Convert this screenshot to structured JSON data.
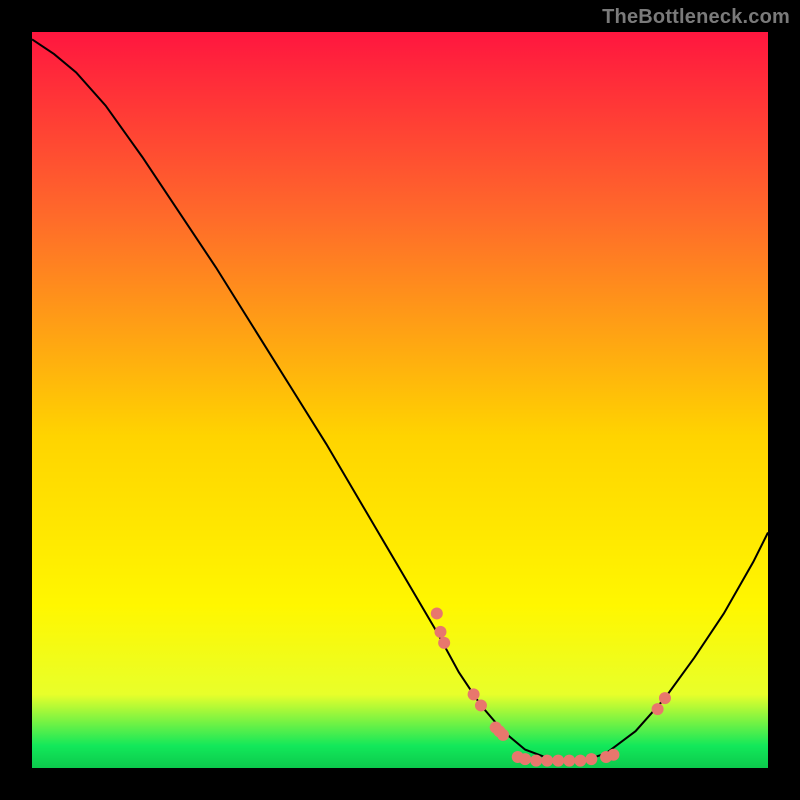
{
  "watermark": "TheBottleneck.com",
  "chart_data": {
    "type": "line",
    "title": "",
    "xlabel": "",
    "ylabel": "",
    "xlim": [
      0,
      100
    ],
    "ylim": [
      0,
      100
    ],
    "background_gradient": {
      "stops": [
        {
          "pct": 0,
          "color": "#ff163f"
        },
        {
          "pct": 25,
          "color": "#ff6a2a"
        },
        {
          "pct": 55,
          "color": "#ffd400"
        },
        {
          "pct": 78,
          "color": "#fff700"
        },
        {
          "pct": 90,
          "color": "#e8ff2a"
        },
        {
          "pct": 97,
          "color": "#12e85a"
        },
        {
          "pct": 100,
          "color": "#0cc94c"
        }
      ]
    },
    "series": [
      {
        "name": "bottleneck-curve",
        "color": "#000000",
        "x": [
          0,
          3,
          6,
          10,
          15,
          20,
          25,
          30,
          35,
          40,
          45,
          50,
          55,
          58,
          61,
          64,
          67,
          71,
          75,
          78,
          82,
          86,
          90,
          94,
          98,
          100
        ],
        "y": [
          99,
          97,
          94.5,
          90,
          83,
          75.5,
          68,
          60,
          52,
          44,
          35.5,
          27,
          18.5,
          13,
          8.5,
          5,
          2.5,
          1,
          1,
          2,
          5,
          9.5,
          15,
          21,
          28,
          32
        ]
      }
    ],
    "markers": {
      "name": "sample-points",
      "color": "#e8776d",
      "radius": 6,
      "points": [
        {
          "x": 55,
          "y": 21
        },
        {
          "x": 55.5,
          "y": 18.5
        },
        {
          "x": 56,
          "y": 17
        },
        {
          "x": 60,
          "y": 10
        },
        {
          "x": 61,
          "y": 8.5
        },
        {
          "x": 63,
          "y": 5.5
        },
        {
          "x": 63.5,
          "y": 5
        },
        {
          "x": 64,
          "y": 4.5
        },
        {
          "x": 66,
          "y": 1.5
        },
        {
          "x": 67,
          "y": 1.2
        },
        {
          "x": 68.5,
          "y": 1
        },
        {
          "x": 70,
          "y": 1
        },
        {
          "x": 71.5,
          "y": 1
        },
        {
          "x": 73,
          "y": 1
        },
        {
          "x": 74.5,
          "y": 1
        },
        {
          "x": 76,
          "y": 1.2
        },
        {
          "x": 78,
          "y": 1.5
        },
        {
          "x": 79,
          "y": 1.8
        },
        {
          "x": 85,
          "y": 8
        },
        {
          "x": 86,
          "y": 9.5
        }
      ]
    }
  }
}
